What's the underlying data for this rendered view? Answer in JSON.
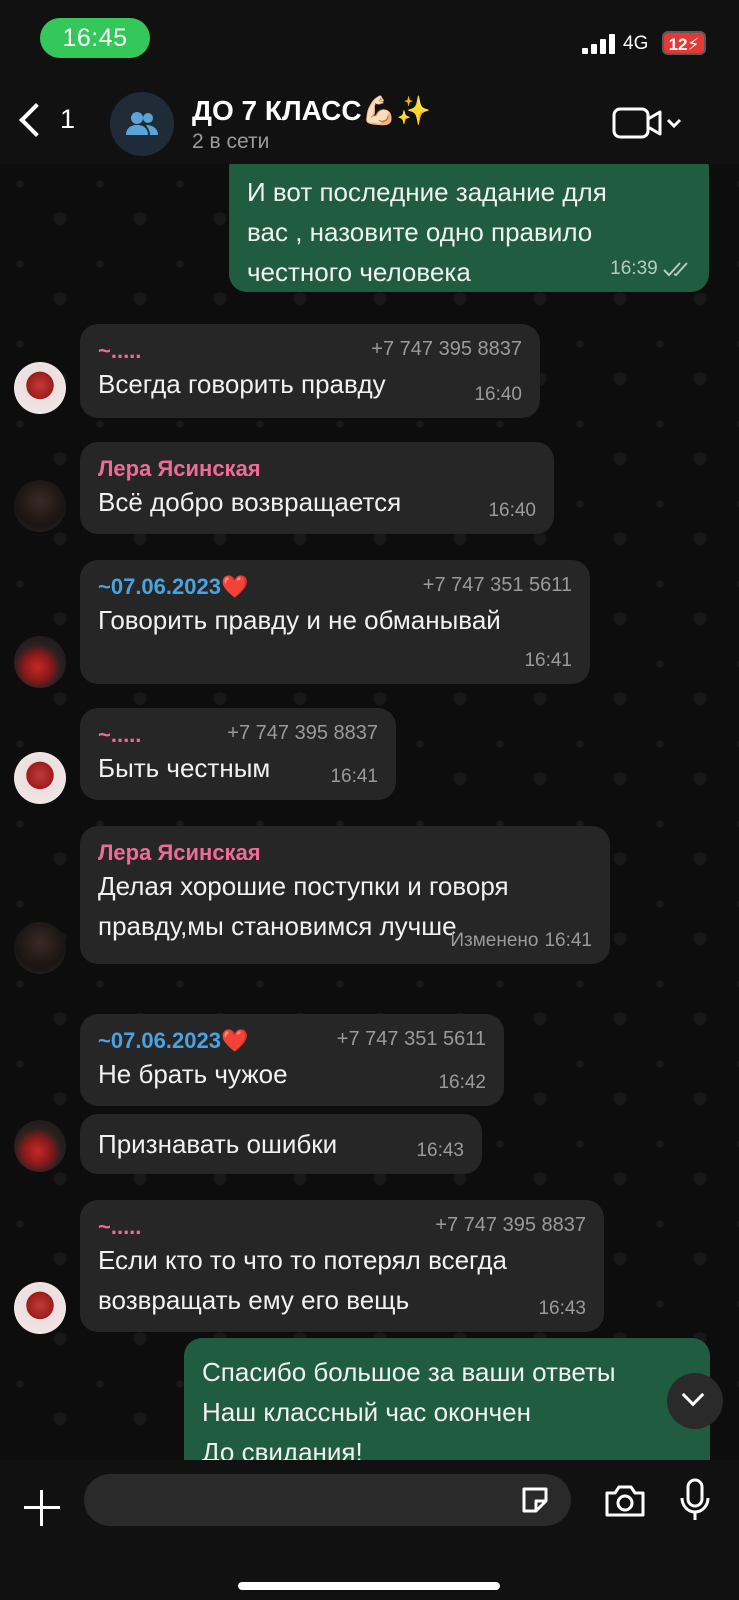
{
  "status_bar": {
    "time": "16:45",
    "network": "4G",
    "battery": "12"
  },
  "header": {
    "back_count": "1",
    "title": "ДО 7 КЛАСС💪🏻✨",
    "subtitle": "2 в сети"
  },
  "messages": [
    {
      "direction": "out",
      "text_lines": [
        "И вот последние задание для",
        "вас , назовите одно правило",
        "честного человека"
      ],
      "time": "16:39",
      "read": true
    },
    {
      "direction": "in",
      "sender": "~.....",
      "sender_color": "#ef6b9a",
      "phone": "+7 747 395 8837",
      "text": "Всегда говорить правду",
      "time": "16:40"
    },
    {
      "direction": "in",
      "sender": "Лера Ясинская",
      "sender_color": "#ef6b9a",
      "text": "Всё добро возвращается",
      "time": "16:40"
    },
    {
      "direction": "in",
      "sender": "~07.06.2023❤️",
      "sender_color": "#4aa3df",
      "phone": "+7 747 351 5611",
      "text": "Говорить правду и не обманывай",
      "time": "16:41"
    },
    {
      "direction": "in",
      "sender": "~.....",
      "sender_color": "#ef6b9a",
      "phone": "+7 747 395 8837",
      "text": "Быть честным",
      "time": "16:41"
    },
    {
      "direction": "in",
      "sender": "Лера Ясинская",
      "sender_color": "#ef6b9a",
      "text_lines": [
        "Делая хорошие поступки и говоря",
        "правду,мы становимся лучше"
      ],
      "edited_label": "Изменено",
      "time": "16:41"
    },
    {
      "direction": "in",
      "sender": "~07.06.2023❤️",
      "sender_color": "#4aa3df",
      "phone": "+7 747 351 5611",
      "text": "Не брать чужое",
      "time": "16:42"
    },
    {
      "direction": "in",
      "text": "Признавать ошибки",
      "time": "16:43"
    },
    {
      "direction": "in",
      "sender": "~.....",
      "sender_color": "#ef6b9a",
      "phone": "+7 747 395 8837",
      "text_lines": [
        "Если кто то что то потерял всегда",
        "возвращать ему его вещь"
      ],
      "time": "16:43"
    },
    {
      "direction": "out",
      "text_lines": [
        "Спасибо большое за ваши ответы",
        "Наш классный час окончен",
        "До свидания!"
      ]
    }
  ],
  "input": {
    "placeholder": "",
    "value": ""
  },
  "icons": {
    "group_avatar": "group-icon",
    "video_call": "video-camera-icon",
    "attach": "plus-icon",
    "sticker": "sticker-icon",
    "camera": "camera-icon",
    "mic": "microphone-icon",
    "scroll_down": "chevron-down-icon",
    "read_status": "double-check-icon"
  },
  "colors": {
    "outgoing_bubble": "#1f5c40",
    "incoming_bubble": "#262626",
    "time_pill": "#34c759",
    "battery": "#e53935"
  }
}
